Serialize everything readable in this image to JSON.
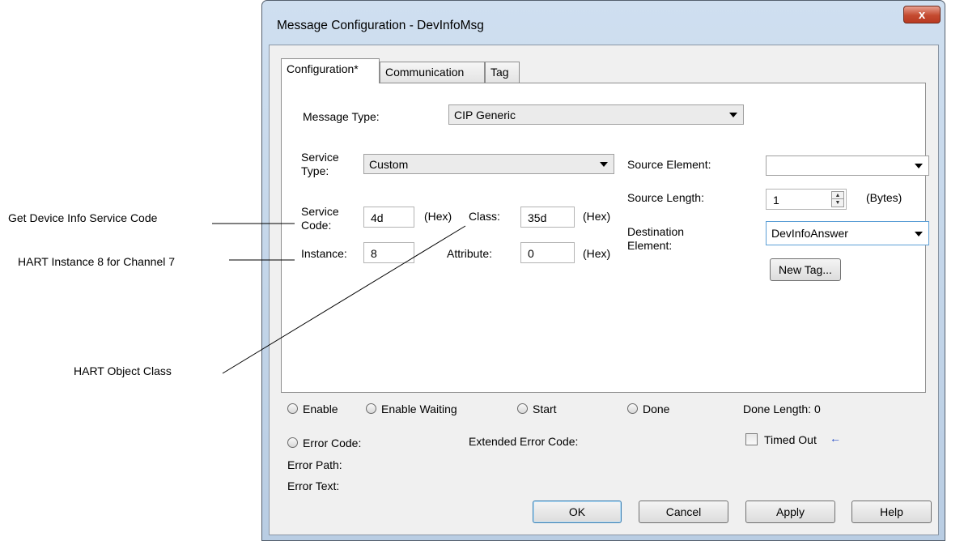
{
  "callouts": {
    "service_code": "Get Device Info Service Code",
    "instance": "HART Instance 8 for Channel 7",
    "object_class": "HART Object Class"
  },
  "dialog": {
    "title": "Message Configuration - DevInfoMsg",
    "close_glyph": "x",
    "tabs": [
      "Configuration*",
      "Communication",
      "Tag"
    ]
  },
  "config": {
    "message_type_label": "Message Type:",
    "message_type_value": "CIP Generic",
    "service_type_label": "Service Type:",
    "service_type_value": "Custom",
    "service_code_label": "Service Code:",
    "service_code_value": "4d",
    "class_label": "Class:",
    "class_value": "35d",
    "instance_label": "Instance:",
    "instance_value": "8",
    "attribute_label": "Attribute:",
    "attribute_value": "0",
    "hex_label": "(Hex)",
    "source_element_label": "Source Element:",
    "source_element_value": "",
    "source_length_label": "Source Length:",
    "source_length_value": "1",
    "bytes_label": "(Bytes)",
    "destination_label": "Destination Element:",
    "destination_value": "DevInfoAnswer",
    "new_tag_label": "New Tag..."
  },
  "status": {
    "enable": "Enable",
    "enable_waiting": "Enable Waiting",
    "start": "Start",
    "done": "Done",
    "done_length": "Done Length: 0",
    "error_code": "Error Code:",
    "extended_error_code": "Extended Error Code:",
    "timed_out": "Timed Out",
    "timed_out_arrow": "←",
    "error_path": "Error Path:",
    "error_text": "Error Text:"
  },
  "buttons": {
    "ok": "OK",
    "cancel": "Cancel",
    "apply": "Apply",
    "help": "Help"
  }
}
